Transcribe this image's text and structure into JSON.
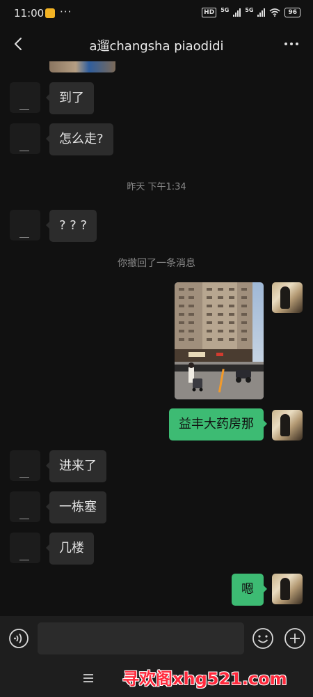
{
  "status_bar": {
    "time": "11:00",
    "more_dots": "···",
    "hd": "HD",
    "net1": "5G",
    "net2": "5G",
    "battery": "96"
  },
  "header": {
    "title": "a遛changsha piaodidi",
    "back_icon": "chevron-left-icon",
    "more_icon": "more-horizontal-icon"
  },
  "messages": {
    "in_1": "到了",
    "in_2": "怎么走?",
    "timestamp": "昨天 下午1:34",
    "in_3": "? ? ?",
    "recall_notice": "你撤回了一条消息",
    "out_text": "益丰大药房那",
    "in_4": "进来了",
    "in_5": "一栋塞",
    "in_6": "几楼",
    "out_last": "嗯"
  },
  "photo": {
    "sign_text": "海驿 药房"
  },
  "input_bar": {
    "placeholder": "",
    "voice_icon": "voice-icon",
    "emoji_icon": "emoji-icon",
    "plus_icon": "plus-circle-icon"
  },
  "nav": {
    "menu_icon": "menu-icon",
    "watermark": "寻欢阁xhg521.com"
  },
  "colors": {
    "background": "#111111",
    "bubble_in": "#2c2c2c",
    "bubble_out": "#3dbb73",
    "watermark": "#ff2a3d"
  }
}
